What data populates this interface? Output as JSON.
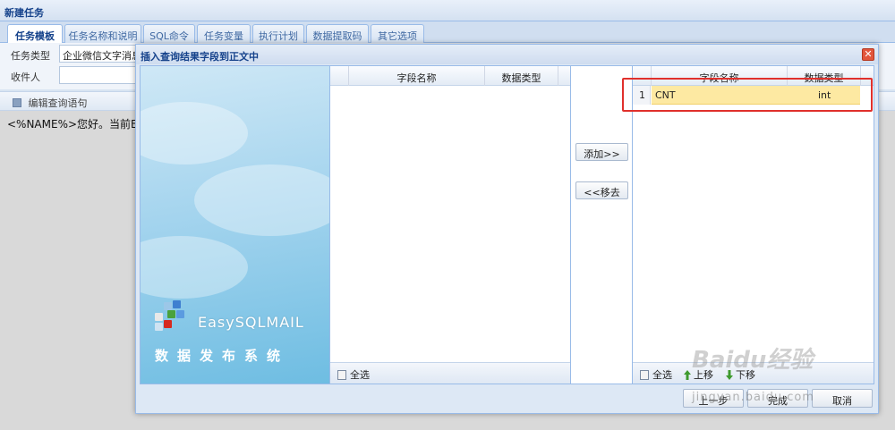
{
  "window": {
    "title": "新建任务"
  },
  "tabs": [
    {
      "label": "任务模板"
    },
    {
      "label": "任务名称和说明"
    },
    {
      "label": "SQL命令"
    },
    {
      "label": "任务变量"
    },
    {
      "label": "执行计划"
    },
    {
      "label": "数据提取码"
    },
    {
      "label": "其它选项"
    }
  ],
  "form": {
    "task_type_label": "任务类型",
    "task_type_value": "企业微信文字消息",
    "recipient_label": "收件人",
    "recipient_value": ""
  },
  "editor": {
    "toolbar_label": "编辑查询语句",
    "content": "<%NAME%>您好。当前ER"
  },
  "dialog": {
    "title": "插入查询结果字段到正文中",
    "close": "✕",
    "brand_name": "EasySQLMAIL",
    "brand_sub": "数据发布系统",
    "left_grid": {
      "columns": [
        "字段名称",
        "数据类型"
      ],
      "rows": [],
      "select_all": "全选"
    },
    "add_button": "添加>>",
    "remove_button": "<<移去",
    "right_grid": {
      "columns": [
        "字段名称",
        "数据类型"
      ],
      "rows": [
        {
          "no": "1",
          "name": "CNT",
          "type": "int"
        }
      ],
      "select_all": "全选",
      "move_up": "上移",
      "move_down": "下移"
    },
    "footer": {
      "prev": "上一步",
      "finish": "完成",
      "cancel": "取消"
    }
  },
  "watermark": {
    "logo": "Baidu经验",
    "url": "jingyan.baidu.com"
  },
  "colors": {
    "accent": "#15428b",
    "selection": "#fde9a2",
    "highlight_box": "#e0302c"
  }
}
